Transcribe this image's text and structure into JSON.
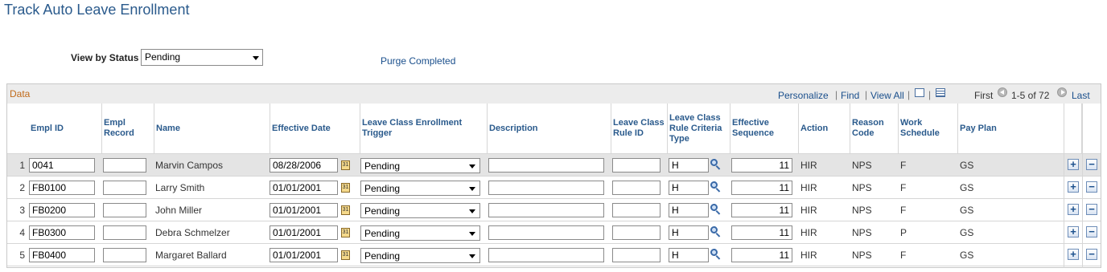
{
  "page": {
    "title": "Track Auto Leave Enrollment"
  },
  "filter": {
    "label": "View by Status",
    "value": "Pending"
  },
  "purge_link": "Purge Completed",
  "grid": {
    "title": "Data",
    "personalize": "Personalize",
    "find": "Find",
    "view_all": "View All",
    "first": "First",
    "range": "1-5 of 72",
    "last": "Last",
    "columns": {
      "empl_id": "Empl ID",
      "empl_record": "Empl Record",
      "name": "Name",
      "effective_date": "Effective Date",
      "trigger": "Leave Class Enrollment Trigger",
      "description": "Description",
      "rule_id": "Leave Class Rule ID",
      "criteria_type": "Leave Class Rule Criteria Type",
      "eff_seq": "Effective Sequence",
      "action": "Action",
      "reason": "Reason Code",
      "schedule": "Work Schedule",
      "pay_plan": "Pay Plan"
    },
    "rows": [
      {
        "num": "1",
        "empl_id": "0041",
        "empl_record": "",
        "name": "Marvin Campos",
        "effective_date": "08/28/2006",
        "trigger": "Pending",
        "description": "",
        "rule_id": "",
        "criteria_type": "H",
        "eff_seq": "11",
        "action": "HIR",
        "reason": "NPS",
        "schedule": "F",
        "pay_plan": "GS"
      },
      {
        "num": "2",
        "empl_id": "FB0100",
        "empl_record": "",
        "name": "Larry Smith",
        "effective_date": "01/01/2001",
        "trigger": "Pending",
        "description": "",
        "rule_id": "",
        "criteria_type": "H",
        "eff_seq": "11",
        "action": "HIR",
        "reason": "NPS",
        "schedule": "F",
        "pay_plan": "GS"
      },
      {
        "num": "3",
        "empl_id": "FB0200",
        "empl_record": "",
        "name": "John Miller",
        "effective_date": "01/01/2001",
        "trigger": "Pending",
        "description": "",
        "rule_id": "",
        "criteria_type": "H",
        "eff_seq": "11",
        "action": "HIR",
        "reason": "NPS",
        "schedule": "F",
        "pay_plan": "GS"
      },
      {
        "num": "4",
        "empl_id": "FB0300",
        "empl_record": "",
        "name": "Debra Schmelzer",
        "effective_date": "01/01/2001",
        "trigger": "Pending",
        "description": "",
        "rule_id": "",
        "criteria_type": "H",
        "eff_seq": "11",
        "action": "HIR",
        "reason": "NPS",
        "schedule": "P",
        "pay_plan": "GS"
      },
      {
        "num": "5",
        "empl_id": "FB0400",
        "empl_record": "",
        "name": "Margaret Ballard",
        "effective_date": "01/01/2001",
        "trigger": "Pending",
        "description": "",
        "rule_id": "",
        "criteria_type": "H",
        "eff_seq": "11",
        "action": "HIR",
        "reason": "NPS",
        "schedule": "F",
        "pay_plan": "GS"
      }
    ]
  }
}
